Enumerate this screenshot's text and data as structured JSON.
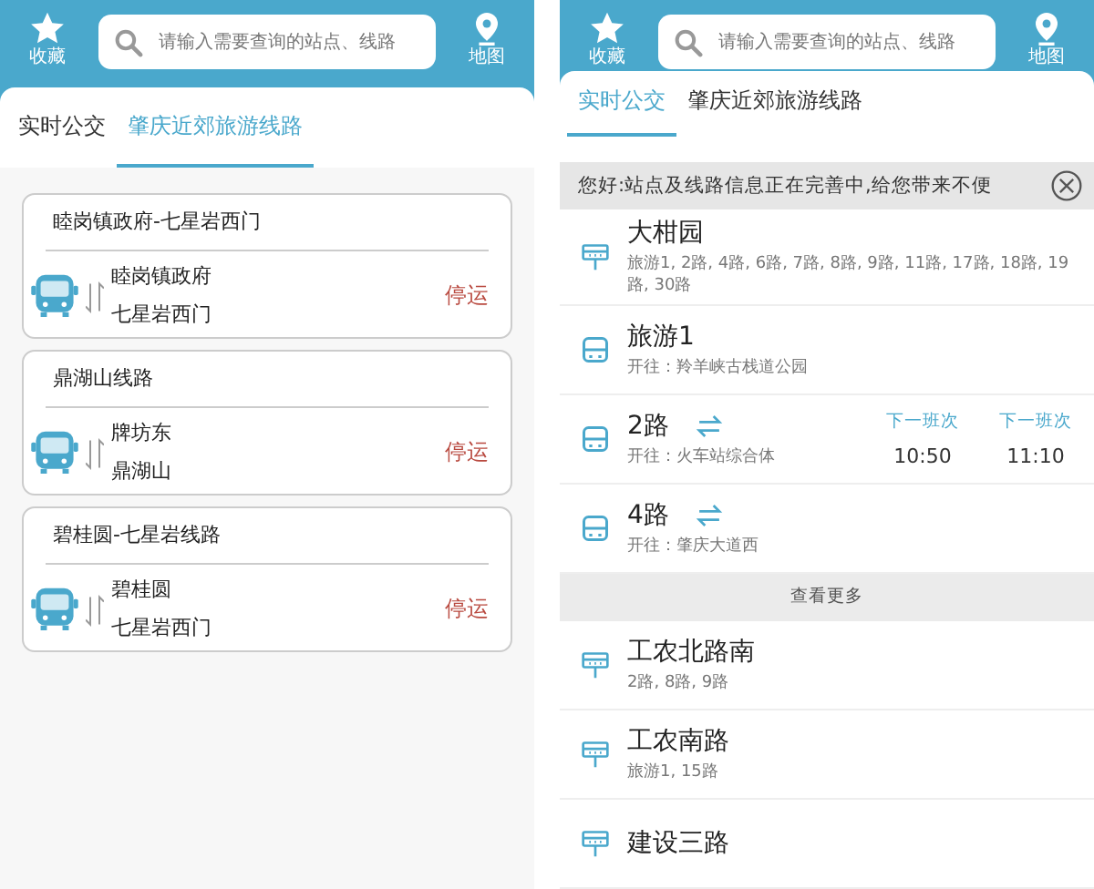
{
  "screens": [
    {
      "header": {
        "favorites_label": "收藏",
        "search_placeholder": "请输入需要查询的站点、线路",
        "map_label": "地图"
      },
      "tabs": [
        {
          "label": "实时公交",
          "selected": false
        },
        {
          "label": "肇庆近郊旅游线路",
          "selected": true
        }
      ],
      "routes": [
        {
          "name": "睦岗镇政府-七星岩西门",
          "from": "睦岗镇政府",
          "to": "七星岩西门",
          "status": "停运"
        },
        {
          "name": "鼎湖山线路",
          "from": "牌坊东",
          "to": "鼎湖山",
          "status": "停运"
        },
        {
          "name": "碧桂圆-七星岩线路",
          "from": "碧桂圆",
          "to": "七星岩西门",
          "status": "停运"
        }
      ]
    },
    {
      "header": {
        "favorites_label": "收藏",
        "search_placeholder": "请输入需要查询的站点、线路",
        "map_label": "地图"
      },
      "tabs": [
        {
          "label": "实时公交",
          "selected": true
        },
        {
          "label": "肇庆近郊旅游线路",
          "selected": false
        }
      ],
      "notice": "您好:站点及线路信息正在完善中,给您带来不便",
      "items": [
        {
          "kind": "stop",
          "title": "大柑园",
          "detail": "旅游1, 2路, 4路, 6路, 7路, 8路, 9路, 11路, 17路, 18路, 19路, 30路"
        },
        {
          "kind": "route",
          "title": "旅游1",
          "detail": "开往：羚羊峡古栈道公园",
          "swap": false
        },
        {
          "kind": "route",
          "title": "2路",
          "detail": "开往：火车站综合体",
          "swap": true,
          "departures": [
            {
              "label": "下一班次",
              "time": "10:50"
            },
            {
              "label": "下一班次",
              "time": "11:10"
            }
          ]
        },
        {
          "kind": "route",
          "title": "4路",
          "detail": "开往：肇庆大道西",
          "swap": true
        },
        {
          "kind": "more",
          "title": "查看更多"
        },
        {
          "kind": "stop",
          "title": "工农北路南",
          "detail": "2路, 8路, 9路"
        },
        {
          "kind": "stop",
          "title": "工农南路",
          "detail": "旅游1, 15路"
        },
        {
          "kind": "stop",
          "title": "建设三路"
        }
      ]
    }
  ]
}
